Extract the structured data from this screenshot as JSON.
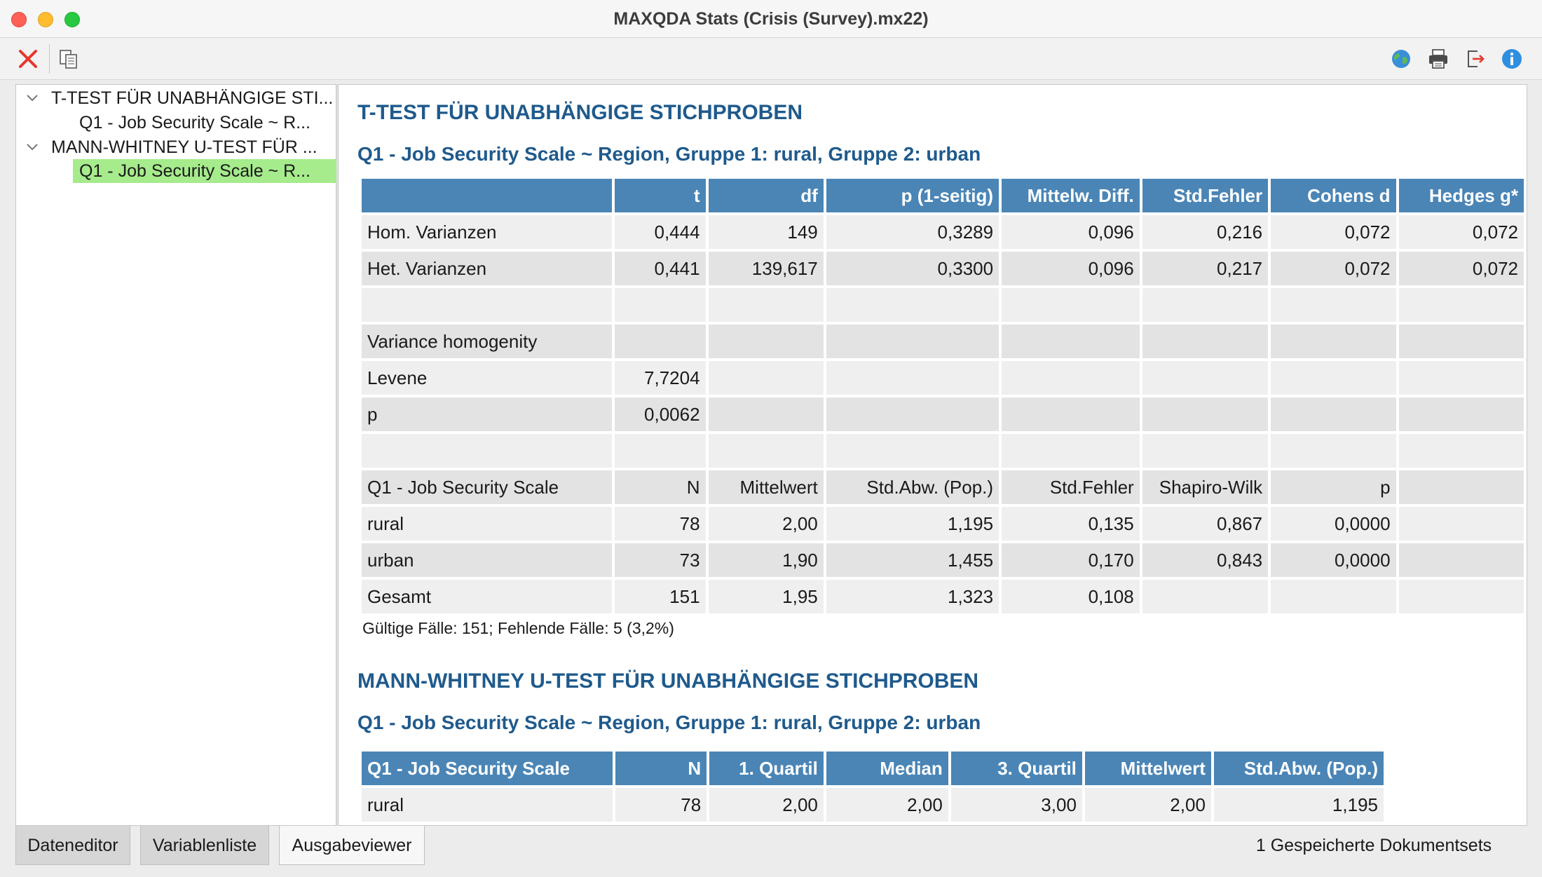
{
  "window": {
    "title": "MAXQDA Stats (Crisis (Survey).mx22)"
  },
  "toolbar": {
    "left_icons": [
      "close-red-x-icon",
      "copy-icon"
    ],
    "right_icons": [
      "globe-icon",
      "print-icon",
      "export-icon",
      "info-icon"
    ]
  },
  "tree": {
    "items": [
      {
        "label": "T-TEST FÜR UNABHÄNGIGE STI...",
        "expanded": true,
        "children": [
          {
            "label": "Q1 - Job Security Scale ~ R...",
            "selected": false
          }
        ]
      },
      {
        "label": "MANN-WHITNEY U-TEST FÜR ...",
        "expanded": true,
        "children": [
          {
            "label": "Q1 - Job Security Scale ~ R...",
            "selected": true
          }
        ]
      }
    ],
    "selected_color": "#a6eb8c"
  },
  "output": {
    "sections": [
      {
        "title": "T-TEST FÜR UNABHÄNGIGE STICHPROBEN",
        "subtitle": "Q1 - Job Security Scale ~ Region, Gruppe 1: rural, Gruppe 2: urban",
        "headers": [
          "",
          "t",
          "df",
          "p (1-seitig)",
          "Mittelw. Diff.",
          "Std.Fehler",
          "Cohens d",
          "Hedges g*"
        ],
        "rows": [
          [
            "Hom. Varianzen",
            "0,444",
            "149",
            "0,3289",
            "0,096",
            "0,216",
            "0,072",
            "0,072"
          ],
          [
            "Het. Varianzen",
            "0,441",
            "139,617",
            "0,3300",
            "0,096",
            "0,217",
            "0,072",
            "0,072"
          ],
          [
            "",
            "",
            "",
            "",
            "",
            "",
            "",
            ""
          ],
          [
            "Variance homogenity",
            "",
            "",
            "",
            "",
            "",
            "",
            ""
          ],
          [
            "Levene",
            "7,7204",
            "",
            "",
            "",
            "",
            "",
            ""
          ],
          [
            "p",
            "0,0062",
            "",
            "",
            "",
            "",
            "",
            ""
          ],
          [
            "",
            "",
            "",
            "",
            "",
            "",
            "",
            ""
          ],
          [
            "Q1 - Job Security Scale",
            "N",
            "Mittelwert",
            "Std.Abw. (Pop.)",
            "Std.Fehler",
            "Shapiro-Wilk",
            "p",
            ""
          ],
          [
            "rural",
            "78",
            "2,00",
            "1,195",
            "0,135",
            "0,867",
            "0,0000",
            ""
          ],
          [
            "urban",
            "73",
            "1,90",
            "1,455",
            "0,170",
            "0,843",
            "0,0000",
            ""
          ],
          [
            "Gesamt",
            "151",
            "1,95",
            "1,323",
            "0,108",
            "",
            "",
            ""
          ]
        ],
        "footnote": "Gültige Fälle: 151; Fehlende Fälle: 5 (3,2%)"
      },
      {
        "title": "MANN-WHITNEY U-TEST FÜR UNABHÄNGIGE STICHPROBEN",
        "subtitle": "Q1 - Job Security Scale ~ Region, Gruppe 1: rural, Gruppe 2: urban",
        "headers": [
          "Q1 - Job Security Scale",
          "N",
          "1. Quartil",
          "Median",
          "3. Quartil",
          "Mittelwert",
          "Std.Abw. (Pop.)"
        ],
        "rows": [
          [
            "rural",
            "78",
            "2,00",
            "2,00",
            "3,00",
            "2,00",
            "1,195"
          ]
        ]
      }
    ],
    "header_color": "#4a85b6",
    "title_color": "#1f5a8c"
  },
  "bottom_tabs": {
    "tabs": [
      {
        "label": "Dateneditor",
        "active": false
      },
      {
        "label": "Variablenliste",
        "active": false
      },
      {
        "label": "Ausgabeviewer",
        "active": true
      }
    ],
    "status": "1 Gespeicherte Dokumentsets"
  }
}
